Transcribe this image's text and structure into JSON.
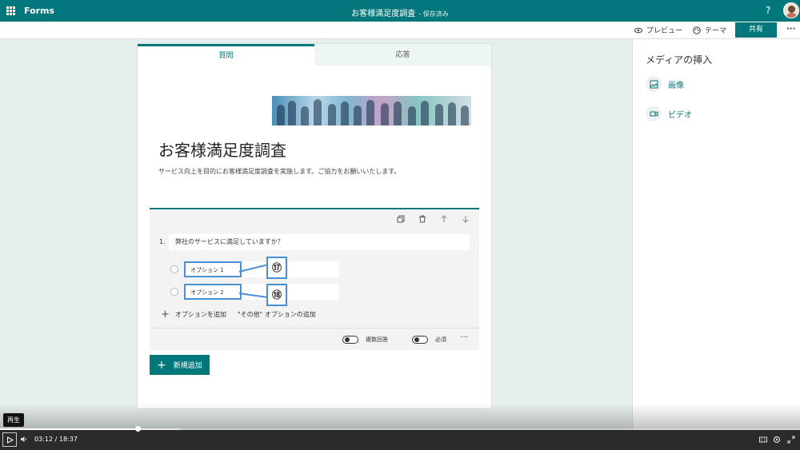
{
  "app": {
    "name": "Forms",
    "document_title": "お客様満足度調査",
    "save_status": "- 保存済み",
    "help_label": "?"
  },
  "toolbar": {
    "preview_label": "プレビュー",
    "theme_label": "テーマ",
    "share_label": "共有",
    "more_label": "···"
  },
  "tabs": {
    "questions_label": "質問",
    "responses_label": "応答"
  },
  "form": {
    "title": "お客様満足度調査",
    "description": "サービス向上を目的にお客様満足度調査を実施します。ご協力をお願いいたします。"
  },
  "question": {
    "number": "1.",
    "text": "弊社のサービスに満足していますか？",
    "options": [
      {
        "label": "オプション 1",
        "callout": "⑰"
      },
      {
        "label": "オプション 2",
        "callout": "⑱"
      }
    ],
    "add_option_label": "オプションを追加",
    "add_other_label": "\"その他\" オプションの追加",
    "multiple_answers_label": "複数回答",
    "required_label": "必須",
    "more_label": "···"
  },
  "new_button_label": "新規追加",
  "media_pane": {
    "title": "メディアの挿入",
    "image_label": "画像",
    "video_label": "ビデオ"
  },
  "player": {
    "tooltip": "再生",
    "current_time": "03:12",
    "separator": "/",
    "total_time": "18:37",
    "progress": 0.172,
    "buffered": 0.225
  },
  "colors": {
    "brand": "#03787c",
    "callout": "#4a8fcf",
    "background": "#e6eeee"
  }
}
